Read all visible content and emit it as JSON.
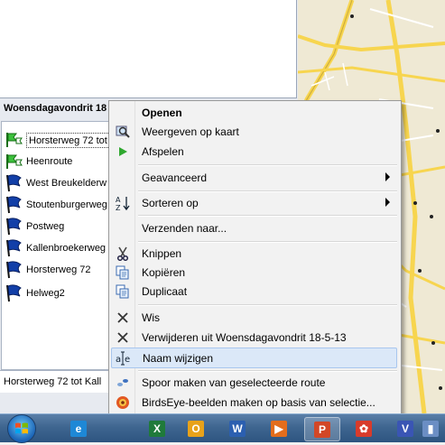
{
  "group_header": "Woensdagavondrit 18",
  "routes": [
    {
      "label": "Horsterweg 72 tot",
      "icon": "route-flag-icon",
      "selected": true
    },
    {
      "label": "Heenroute",
      "icon": "route-flag-icon"
    },
    {
      "label": "West Breukelderw",
      "icon": "blue-flag-icon"
    },
    {
      "label": "Stoutenburgerweg",
      "icon": "blue-flag-icon"
    },
    {
      "label": "Postweg",
      "icon": "blue-flag-icon"
    },
    {
      "label": "Kallenbroekerweg",
      "icon": "blue-flag-icon"
    },
    {
      "label": "Horsterweg 72",
      "icon": "blue-flag-icon"
    },
    {
      "label": "Helweg2",
      "icon": "blue-flag-icon"
    }
  ],
  "status_line": "Horsterweg 72 tot Kall",
  "context_menu": {
    "items": [
      {
        "label": "Openen",
        "bold": true
      },
      {
        "label": "Weergeven op kaart",
        "icon": "magnifier-map-icon"
      },
      {
        "label": "Afspelen",
        "icon": "play-icon"
      },
      {
        "label": "Geavanceerd",
        "submenu": true
      },
      {
        "label": "Sorteren op",
        "icon": "sort-az-icon",
        "submenu": true
      },
      {
        "label": "Verzenden naar..."
      },
      {
        "label": "Knippen",
        "icon": "scissors-icon"
      },
      {
        "label": "Kopiëren",
        "icon": "copy-icon"
      },
      {
        "label": "Duplicaat",
        "icon": "duplicate-icon"
      },
      {
        "label": "Wis",
        "icon": "delete-x-icon"
      },
      {
        "label": "Verwijderen uit Woensdagavondrit 18-5-13",
        "icon": "remove-x-icon"
      },
      {
        "label": "Naam wijzigen",
        "icon": "rename-icon",
        "highlighted": true
      },
      {
        "label": "Spoor maken van geselecteerde route",
        "icon": "track-icon"
      },
      {
        "label": "BirdsEye-beelden maken op basis van selectie...",
        "icon": "birdseye-icon"
      }
    ]
  },
  "taskbar": {
    "apps": [
      {
        "name": "internet-explorer-icon",
        "glyph": "e",
        "color": "#1e88d6"
      },
      {
        "name": "excel-icon",
        "glyph": "X",
        "color": "#1f7a3a"
      },
      {
        "name": "outlook-icon",
        "glyph": "O",
        "color": "#e8a21a"
      },
      {
        "name": "word-icon",
        "glyph": "W",
        "color": "#2b5fb0"
      },
      {
        "name": "media-player-icon",
        "glyph": "▶",
        "color": "#e36d1c"
      },
      {
        "name": "powerpoint-icon",
        "glyph": "P",
        "color": "#d24726"
      },
      {
        "name": "basecamp-icon",
        "glyph": "✿",
        "color": "#d83b2b"
      },
      {
        "name": "visio-icon",
        "glyph": "V",
        "color": "#3a55b4"
      },
      {
        "name": "app-icon",
        "glyph": "▮",
        "color": "#6b8ec4"
      }
    ]
  }
}
